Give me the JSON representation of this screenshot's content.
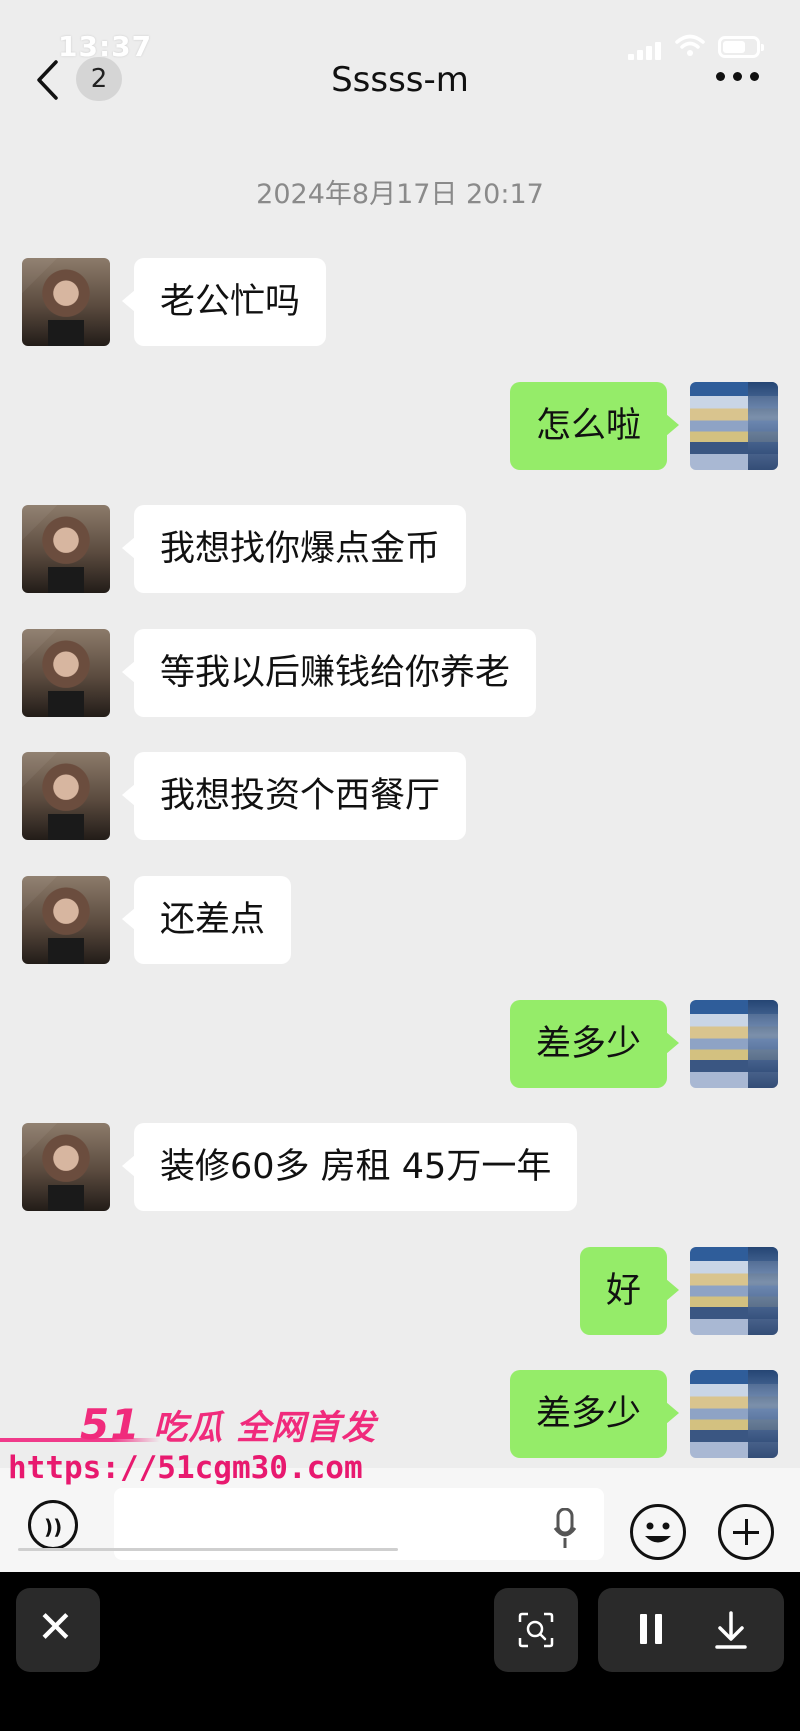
{
  "status_bar": {
    "time": "13:37"
  },
  "nav": {
    "back_badge": "2",
    "title": "Sssss-m"
  },
  "date_divider": "2024年8月17日 20:17",
  "messages": [
    {
      "from": "her",
      "text": "老公忙吗"
    },
    {
      "from": "me",
      "text": "怎么啦"
    },
    {
      "from": "her",
      "text": "我想找你爆点金币"
    },
    {
      "from": "her",
      "text": "等我以后赚钱给你养老"
    },
    {
      "from": "her",
      "text": "我想投资个西餐厅"
    },
    {
      "from": "her",
      "text": "还差点"
    },
    {
      "from": "me",
      "text": "差多少"
    },
    {
      "from": "her",
      "text": "装修60多 房租 45万一年"
    },
    {
      "from": "me",
      "text": "好"
    },
    {
      "from": "me",
      "text": "差多少"
    }
  ],
  "watermark": {
    "num": "51",
    "line1": "吃瓜 全网首发",
    "line2": "https://51cgm30.com"
  },
  "colors": {
    "sent_bubble": "#95ec69",
    "received_bubble": "#ffffff",
    "background": "#ededed",
    "watermark": "#f02b7c"
  },
  "icons": {
    "back": "chevron-left-icon",
    "more": "more-dots-icon",
    "voice": "voice-icon",
    "mic": "mic-icon",
    "emoji": "emoji-icon",
    "plus": "plus-icon",
    "close": "close-icon",
    "lens": "lens-icon",
    "pause": "pause-icon",
    "download": "download-icon"
  }
}
